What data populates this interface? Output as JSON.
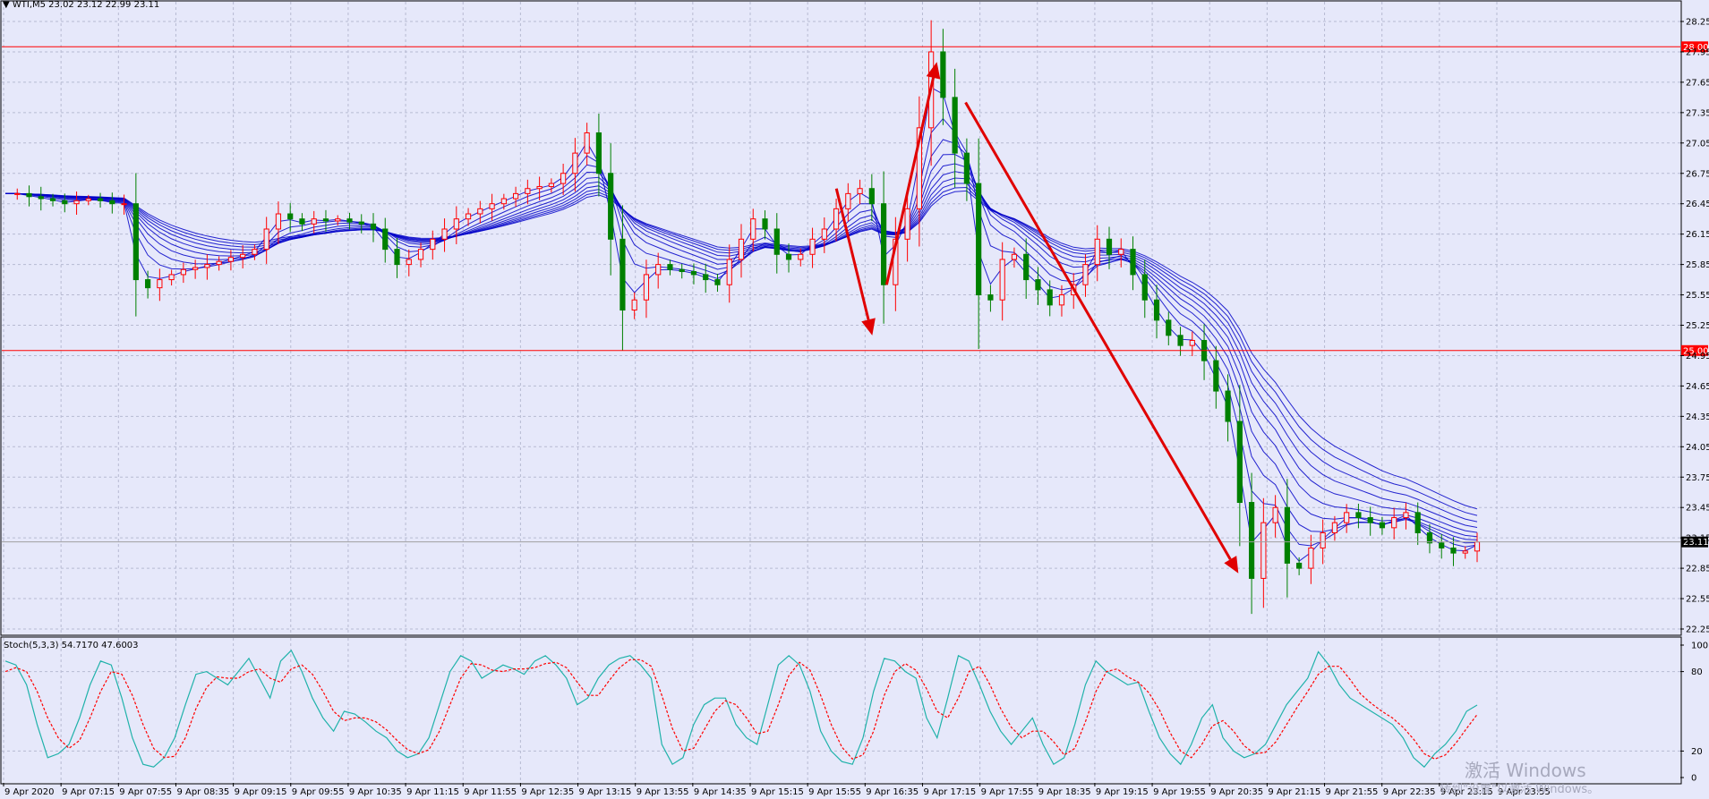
{
  "header": {
    "symbol_line": "▼ WTI,M5  23.02 23.12 22.99 23.11",
    "stoch_line": "Stoch(5,3,3) 54.7170 47.6003"
  },
  "watermark": {
    "line1": "激活 Windows",
    "line2": "转到\"设置\"以激活 Windows。"
  },
  "colors": {
    "background": "#e6e8fa",
    "grid": "#b7bad2",
    "up_candle": "#ff0000",
    "down_candle": "#008000",
    "ma_ribbon": "#0000c8",
    "level_line": "#ff0000",
    "arrow": "#e00000",
    "stoch_main": "#20b2aa",
    "stoch_signal": "#ff0000"
  },
  "chart_data": [
    {
      "type": "candlestick",
      "symbol": "WTI",
      "timeframe": "M5",
      "ylim": [
        22.25,
        28.25
      ],
      "y_ticks": [
        "28.25",
        "27.95",
        "27.65",
        "27.35",
        "27.05",
        "26.75",
        "26.45",
        "26.15",
        "25.85",
        "25.55",
        "25.25",
        "24.95",
        "24.65",
        "24.35",
        "24.05",
        "23.75",
        "23.45",
        "23.15",
        "22.85",
        "22.55",
        "22.25"
      ],
      "x_ticks": [
        "9 Apr 2020",
        "9 Apr 07:15",
        "9 Apr 07:55",
        "9 Apr 08:35",
        "9 Apr 09:15",
        "9 Apr 09:55",
        "9 Apr 10:35",
        "9 Apr 11:15",
        "9 Apr 11:55",
        "9 Apr 12:35",
        "9 Apr 13:15",
        "9 Apr 13:55",
        "9 Apr 14:35",
        "9 Apr 15:15",
        "9 Apr 15:55",
        "9 Apr 16:35",
        "9 Apr 17:15",
        "9 Apr 17:55",
        "9 Apr 18:35",
        "9 Apr 19:15",
        "9 Apr 19:55",
        "9 Apr 20:35",
        "9 Apr 21:15",
        "9 Apr 21:55",
        "9 Apr 22:35",
        "9 Apr 23:15",
        "9 Apr 23:55"
      ],
      "last_ohlc": {
        "open": 23.02,
        "high": 23.12,
        "low": 22.99,
        "close": 23.11
      },
      "horizontal_levels": [
        {
          "value": 28.0,
          "label": "28.00"
        },
        {
          "value": 25.0,
          "label": "25.00"
        }
      ],
      "current_price": {
        "value": 23.11,
        "label": "23.11"
      },
      "price_path": [
        26.55,
        26.55,
        26.52,
        26.5,
        26.48,
        26.45,
        26.48,
        26.5,
        26.48,
        26.45,
        26.45,
        25.7,
        25.62,
        25.7,
        25.75,
        25.8,
        25.82,
        25.85,
        25.88,
        25.92,
        25.95,
        26.0,
        26.2,
        26.35,
        26.3,
        26.25,
        26.3,
        26.28,
        26.3,
        26.27,
        26.25,
        26.2,
        26.0,
        25.85,
        25.9,
        26.0,
        26.1,
        26.2,
        26.3,
        26.35,
        26.4,
        26.45,
        26.5,
        26.55,
        26.6,
        26.62,
        26.65,
        26.75,
        26.95,
        27.15,
        26.75,
        26.1,
        25.4,
        25.5,
        25.75,
        25.85,
        25.8,
        25.78,
        25.75,
        25.7,
        25.65,
        25.9,
        26.1,
        26.3,
        26.2,
        25.95,
        25.9,
        25.95,
        26.1,
        26.2,
        26.4,
        26.55,
        26.6,
        26.45,
        25.65,
        26.1,
        26.4,
        27.2,
        27.95,
        27.5,
        26.95,
        26.65,
        25.55,
        25.5,
        25.9,
        25.95,
        25.7,
        25.6,
        25.45,
        25.55,
        25.65,
        25.85,
        26.1,
        25.95,
        26.0,
        25.75,
        25.5,
        25.3,
        25.15,
        25.05,
        25.1,
        24.9,
        24.6,
        24.3,
        23.5,
        22.75,
        23.3,
        23.45,
        22.9,
        22.85,
        23.05,
        23.2,
        23.3,
        23.4,
        23.35,
        23.3,
        23.25,
        23.35,
        23.4,
        23.2,
        23.1,
        23.05,
        23.0,
        23.02,
        23.11
      ],
      "ribbon_ma_count": 10,
      "annotations": [
        {
          "kind": "arrow",
          "direction": "down",
          "from": {
            "time": "9 Apr 16:15",
            "price": 26.6
          },
          "to": {
            "time": "9 Apr 16:40",
            "price": 25.15
          }
        },
        {
          "kind": "arrow",
          "direction": "up",
          "from": {
            "time": "9 Apr 16:50",
            "price": 25.65
          },
          "to": {
            "time": "9 Apr 17:25",
            "price": 27.85
          }
        },
        {
          "kind": "arrow",
          "direction": "down",
          "from": {
            "time": "9 Apr 17:45",
            "price": 27.45
          },
          "to": {
            "time": "9 Apr 20:55",
            "price": 22.8
          }
        }
      ]
    },
    {
      "type": "line",
      "indicator": "Stoch(5,3,3)",
      "ylim": [
        0,
        100
      ],
      "y_ticks": [
        "100",
        "80",
        "20",
        "0"
      ],
      "main_value": 54.717,
      "signal_value": 47.6003,
      "main": [
        88,
        85,
        70,
        40,
        15,
        18,
        25,
        45,
        70,
        88,
        85,
        60,
        30,
        10,
        8,
        15,
        30,
        55,
        78,
        80,
        75,
        70,
        80,
        90,
        75,
        60,
        88,
        96,
        80,
        60,
        45,
        35,
        50,
        48,
        42,
        35,
        30,
        20,
        15,
        18,
        30,
        55,
        80,
        92,
        88,
        75,
        80,
        85,
        82,
        78,
        88,
        92,
        85,
        75,
        55,
        60,
        75,
        85,
        90,
        92,
        85,
        75,
        25,
        10,
        15,
        40,
        55,
        60,
        60,
        40,
        30,
        25,
        55,
        85,
        92,
        85,
        65,
        35,
        20,
        12,
        10,
        30,
        65,
        90,
        88,
        80,
        75,
        45,
        30,
        60,
        92,
        88,
        70,
        50,
        35,
        25,
        35,
        45,
        25,
        10,
        15,
        40,
        70,
        88,
        80,
        75,
        70,
        72,
        50,
        30,
        18,
        10,
        25,
        45,
        55,
        30,
        20,
        15,
        18,
        25,
        40,
        55,
        65,
        75,
        95,
        85,
        70,
        60,
        55,
        50,
        45,
        40,
        30,
        15,
        8,
        18,
        25,
        35,
        50,
        54.7
      ],
      "signal": [
        80,
        83,
        80,
        65,
        45,
        30,
        22,
        28,
        45,
        65,
        80,
        78,
        62,
        40,
        22,
        15,
        16,
        30,
        52,
        68,
        76,
        75,
        75,
        80,
        82,
        75,
        72,
        82,
        85,
        78,
        65,
        50,
        43,
        45,
        45,
        42,
        36,
        28,
        21,
        18,
        21,
        35,
        55,
        75,
        86,
        85,
        81,
        80,
        82,
        82,
        83,
        86,
        87,
        83,
        72,
        62,
        62,
        73,
        83,
        89,
        89,
        84,
        62,
        37,
        20,
        22,
        36,
        50,
        58,
        55,
        45,
        33,
        35,
        55,
        77,
        87,
        81,
        62,
        40,
        23,
        14,
        17,
        35,
        62,
        80,
        86,
        81,
        67,
        50,
        45,
        60,
        80,
        84,
        70,
        52,
        38,
        30,
        35,
        35,
        27,
        17,
        22,
        42,
        65,
        80,
        82,
        76,
        72,
        64,
        51,
        34,
        20,
        15,
        25,
        39,
        43,
        35,
        24,
        18,
        19,
        27,
        40,
        53,
        65,
        78,
        84,
        84,
        74,
        63,
        56,
        50,
        45,
        38,
        29,
        18,
        14,
        17,
        26,
        37,
        47.6
      ]
    }
  ]
}
